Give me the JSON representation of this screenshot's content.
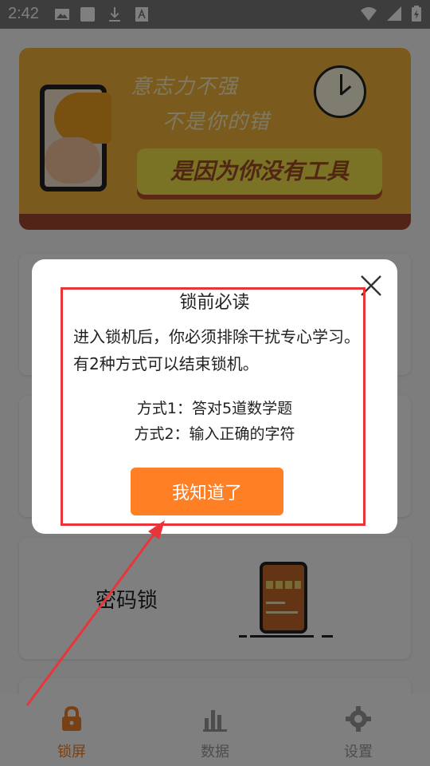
{
  "status_bar": {
    "time": "2:42"
  },
  "banner": {
    "line1": "意志力不强",
    "line2": "不是你的错",
    "slogan": "是因为你没有工具"
  },
  "cards": {
    "password_lock": {
      "title": "密码锁"
    }
  },
  "dialog": {
    "title": "锁前必读",
    "body": "进入锁机后，你必须排除干扰专心学习。有2种方式可以结束锁机。",
    "method1": "方式1：答对5道数学题",
    "method2": "方式2：输入正确的字符",
    "ok_label": "我知道了"
  },
  "nav": {
    "items": [
      {
        "label": "锁屏",
        "active": true
      },
      {
        "label": "数据",
        "active": false
      },
      {
        "label": "设置",
        "active": false
      }
    ]
  },
  "colors": {
    "accent": "#ff7f24",
    "annotation": "#e8353a",
    "banner_bg": "#f6b43b"
  }
}
